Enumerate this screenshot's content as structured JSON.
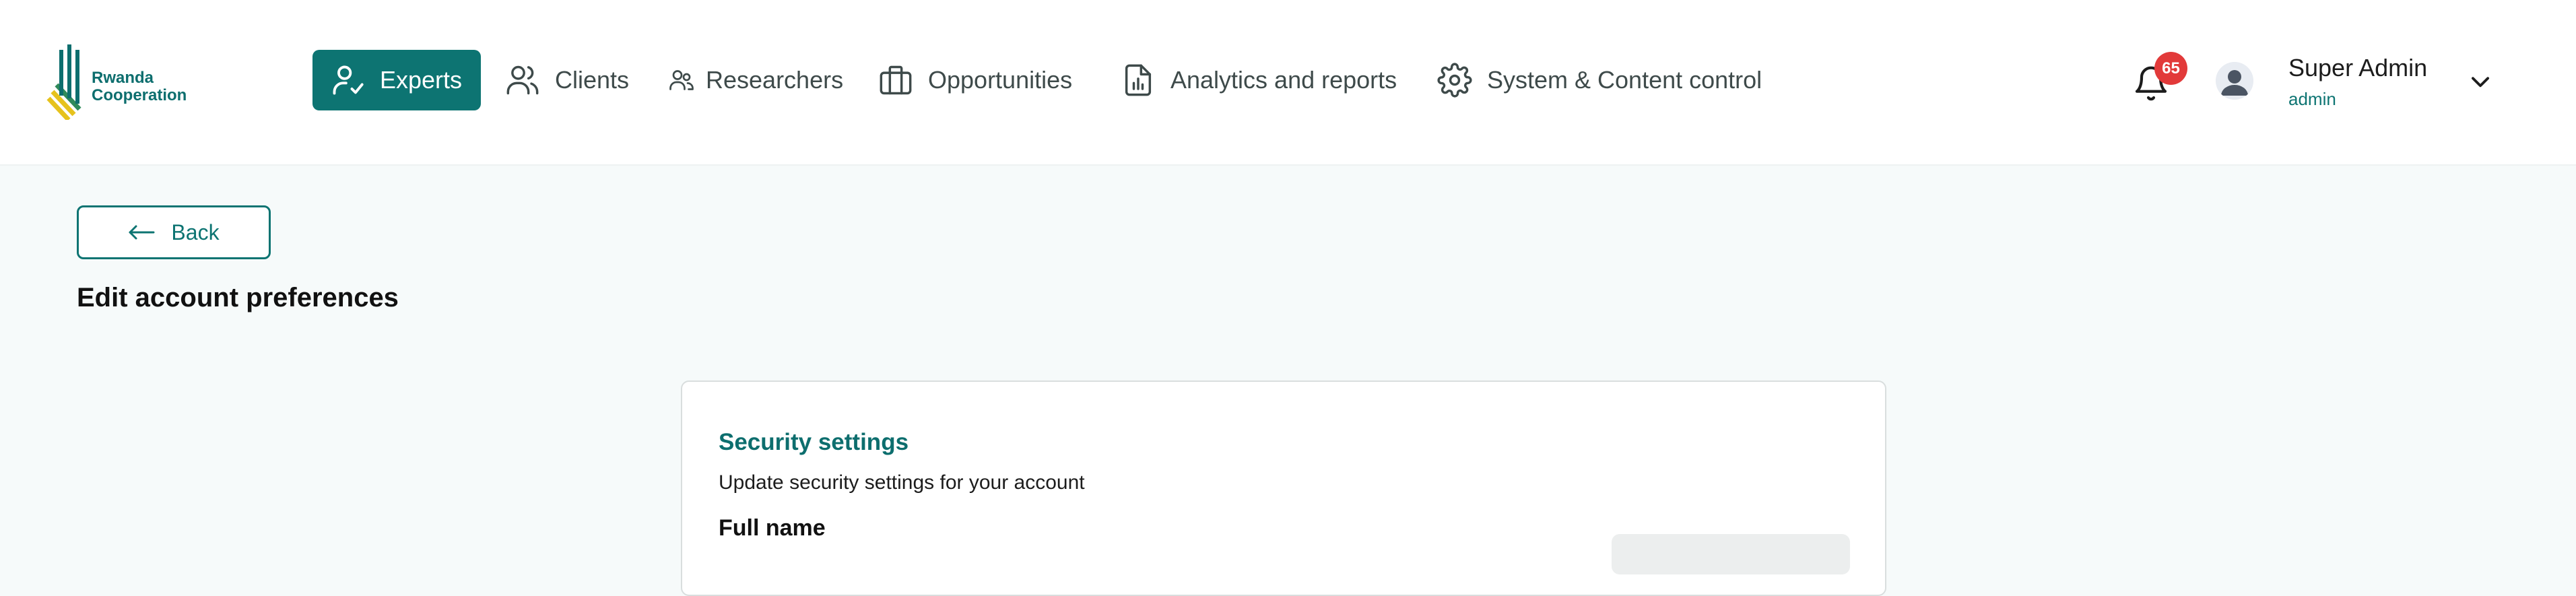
{
  "brand": {
    "logo_line1": "Rwanda",
    "logo_line2": "Cooperation",
    "primary_color": "#0d7472",
    "logo_green": "#2f8a5a",
    "logo_yellow": "#e6c21c"
  },
  "nav": {
    "items": [
      {
        "label": "Experts",
        "icon": "user-check-icon",
        "active": true
      },
      {
        "label": "Clients",
        "icon": "users-icon",
        "active": false
      },
      {
        "label": "Researchers",
        "icon": "researchers-icon",
        "active": false
      },
      {
        "label": "Opportunities",
        "icon": "briefcase-icon",
        "active": false
      },
      {
        "label": "Analytics and reports",
        "icon": "report-file-icon",
        "active": false
      },
      {
        "label": "System & Content control",
        "icon": "gear-icon",
        "active": false
      }
    ]
  },
  "header": {
    "notifications_count": "65",
    "user_name": "Super Admin",
    "user_role": "admin"
  },
  "main": {
    "back_label": "Back",
    "page_title": "Edit account preferences",
    "card": {
      "title": "Security settings",
      "subtitle": "Update security settings for your account",
      "field_label": "Full name",
      "field_value": ""
    }
  }
}
